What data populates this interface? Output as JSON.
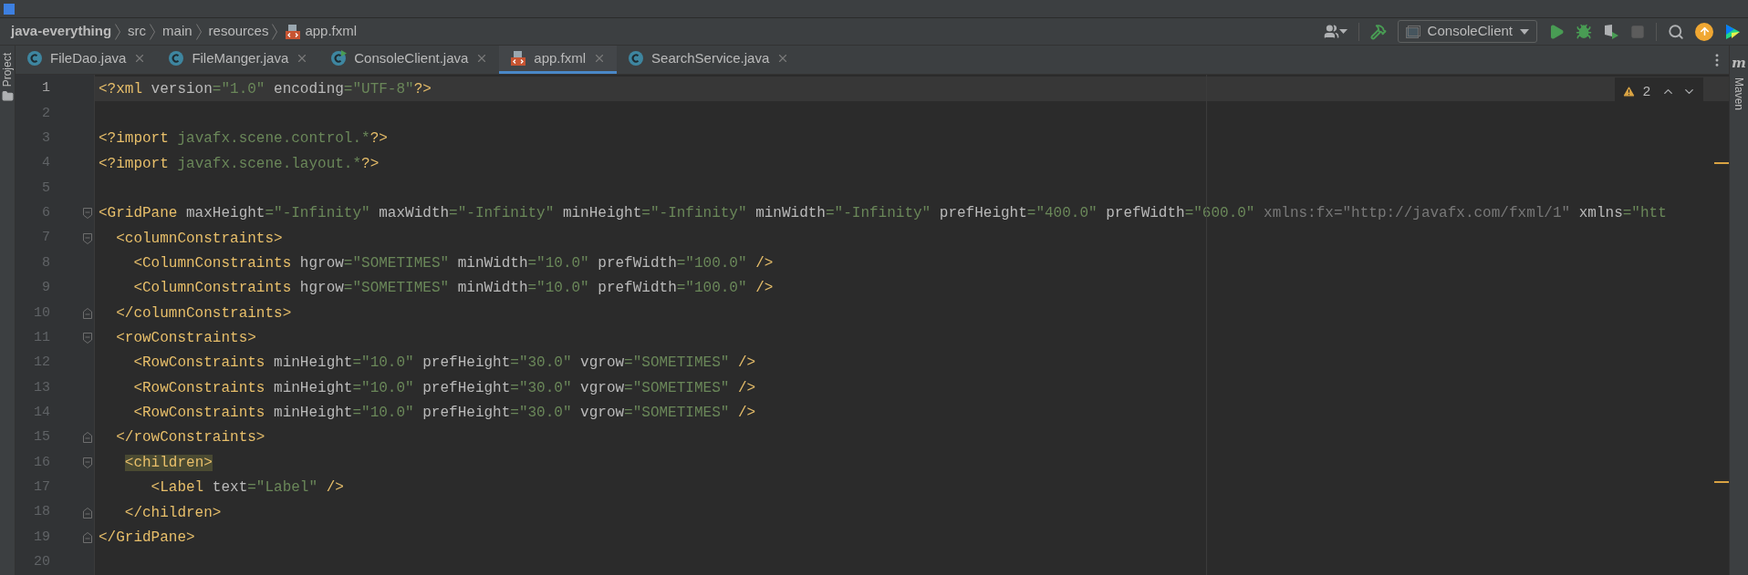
{
  "breadcrumb": [
    {
      "label": "java-everything",
      "kind": "project"
    },
    {
      "label": "src",
      "kind": "folder"
    },
    {
      "label": "main",
      "kind": "folder"
    },
    {
      "label": "resources",
      "kind": "folder"
    },
    {
      "label": "app.fxml",
      "kind": "fxml"
    }
  ],
  "toolbar": {
    "run_config": "ConsoleClient"
  },
  "tabs": [
    {
      "label": "FileDao.java",
      "kind": "class",
      "selected": false
    },
    {
      "label": "FileManger.java",
      "kind": "class",
      "selected": false
    },
    {
      "label": "ConsoleClient.java",
      "kind": "class-run",
      "selected": false
    },
    {
      "label": "app.fxml",
      "kind": "fxml",
      "selected": true
    },
    {
      "label": "SearchService.java",
      "kind": "class",
      "selected": false
    }
  ],
  "left_strip": {
    "label": "Project"
  },
  "right_strip": {
    "label": "Maven",
    "logo": "m"
  },
  "inspections": {
    "warnings": "2"
  },
  "lines": [
    {
      "number": "1",
      "current": true,
      "fold_start": false,
      "fold_end": false,
      "tokens": [
        {
          "kind": "tag",
          "text": "<?xml "
        },
        {
          "kind": "attr",
          "text": "version"
        },
        {
          "kind": "string",
          "text": "=\"1.0\" "
        },
        {
          "kind": "attr",
          "text": "encoding"
        },
        {
          "kind": "string",
          "text": "=\"UTF-8\""
        },
        {
          "kind": "tag",
          "text": "?>"
        }
      ]
    },
    {
      "number": "2",
      "current": false,
      "fold_start": false,
      "fold_end": false
    },
    {
      "number": "3",
      "current": false,
      "fold_start": false,
      "fold_end": false,
      "tokens": [
        {
          "kind": "tag",
          "text": "<?import "
        },
        {
          "kind": "string",
          "text": "javafx.scene.control.*"
        },
        {
          "kind": "tag",
          "text": "?>"
        }
      ]
    },
    {
      "number": "4",
      "current": false,
      "fold_start": false,
      "fold_end": false,
      "tokens": [
        {
          "kind": "tag",
          "text": "<?import "
        },
        {
          "kind": "string",
          "text": "javafx.scene.layout.*"
        },
        {
          "kind": "tag",
          "text": "?>"
        }
      ]
    },
    {
      "number": "5",
      "current": false,
      "fold_start": false,
      "fold_end": false
    },
    {
      "number": "6",
      "current": false,
      "fold_start": true,
      "fold_end": false,
      "tokens": [
        {
          "kind": "tag",
          "text": "<GridPane "
        },
        {
          "kind": "attr",
          "text": "maxHeight"
        },
        {
          "kind": "string",
          "text": "=\"-Infinity\" "
        },
        {
          "kind": "attr",
          "text": "maxWidth"
        },
        {
          "kind": "string",
          "text": "=\"-Infinity\" "
        },
        {
          "kind": "attr",
          "text": "minHeight"
        },
        {
          "kind": "string",
          "text": "=\"-Infinity\" "
        },
        {
          "kind": "attr",
          "text": "minWidth"
        },
        {
          "kind": "string",
          "text": "=\"-Infinity\" "
        },
        {
          "kind": "attr",
          "text": "prefHeight"
        },
        {
          "kind": "string",
          "text": "=\"400.0\" "
        },
        {
          "kind": "attr",
          "text": "prefWidth"
        },
        {
          "kind": "string",
          "text": "=\"600.0\" "
        },
        {
          "kind": "ns",
          "text": "xmlns:fx=\"http://javafx.com/fxml/1\" "
        },
        {
          "kind": "attr",
          "text": "xmlns"
        },
        {
          "kind": "string",
          "text": "=\"htt"
        }
      ]
    },
    {
      "number": "7",
      "current": false,
      "fold_start": true,
      "fold_end": false,
      "tokens": [
        {
          "kind": "tag",
          "text": "  <columnConstraints>"
        }
      ]
    },
    {
      "number": "8",
      "current": false,
      "fold_start": false,
      "fold_end": false,
      "tokens": [
        {
          "kind": "tag",
          "text": "    <ColumnConstraints "
        },
        {
          "kind": "attr",
          "text": "hgrow"
        },
        {
          "kind": "string",
          "text": "=\"SOMETIMES\" "
        },
        {
          "kind": "attr",
          "text": "minWidth"
        },
        {
          "kind": "string",
          "text": "=\"10.0\" "
        },
        {
          "kind": "attr",
          "text": "prefWidth"
        },
        {
          "kind": "string",
          "text": "=\"100.0\" "
        },
        {
          "kind": "tag",
          "text": "/>"
        }
      ]
    },
    {
      "number": "9",
      "current": false,
      "fold_start": false,
      "fold_end": false,
      "tokens": [
        {
          "kind": "tag",
          "text": "    <ColumnConstraints "
        },
        {
          "kind": "attr",
          "text": "hgrow"
        },
        {
          "kind": "string",
          "text": "=\"SOMETIMES\" "
        },
        {
          "kind": "attr",
          "text": "minWidth"
        },
        {
          "kind": "string",
          "text": "=\"10.0\" "
        },
        {
          "kind": "attr",
          "text": "prefWidth"
        },
        {
          "kind": "string",
          "text": "=\"100.0\" "
        },
        {
          "kind": "tag",
          "text": "/>"
        }
      ]
    },
    {
      "number": "10",
      "current": false,
      "fold_start": false,
      "fold_end": true,
      "tokens": [
        {
          "kind": "tag",
          "text": "  </columnConstraints>"
        }
      ]
    },
    {
      "number": "11",
      "current": false,
      "fold_start": true,
      "fold_end": false,
      "tokens": [
        {
          "kind": "tag",
          "text": "  <rowConstraints>"
        }
      ]
    },
    {
      "number": "12",
      "current": false,
      "fold_start": false,
      "fold_end": false,
      "tokens": [
        {
          "kind": "tag",
          "text": "    <RowConstraints "
        },
        {
          "kind": "attr",
          "text": "minHeight"
        },
        {
          "kind": "string",
          "text": "=\"10.0\" "
        },
        {
          "kind": "attr",
          "text": "prefHeight"
        },
        {
          "kind": "string",
          "text": "=\"30.0\" "
        },
        {
          "kind": "attr",
          "text": "vgrow"
        },
        {
          "kind": "string",
          "text": "=\"SOMETIMES\" "
        },
        {
          "kind": "tag",
          "text": "/>"
        }
      ]
    },
    {
      "number": "13",
      "current": false,
      "fold_start": false,
      "fold_end": false,
      "tokens": [
        {
          "kind": "tag",
          "text": "    <RowConstraints "
        },
        {
          "kind": "attr",
          "text": "minHeight"
        },
        {
          "kind": "string",
          "text": "=\"10.0\" "
        },
        {
          "kind": "attr",
          "text": "prefHeight"
        },
        {
          "kind": "string",
          "text": "=\"30.0\" "
        },
        {
          "kind": "attr",
          "text": "vgrow"
        },
        {
          "kind": "string",
          "text": "=\"SOMETIMES\" "
        },
        {
          "kind": "tag",
          "text": "/>"
        }
      ]
    },
    {
      "number": "14",
      "current": false,
      "fold_start": false,
      "fold_end": false,
      "tokens": [
        {
          "kind": "tag",
          "text": "    <RowConstraints "
        },
        {
          "kind": "attr",
          "text": "minHeight"
        },
        {
          "kind": "string",
          "text": "=\"10.0\" "
        },
        {
          "kind": "attr",
          "text": "prefHeight"
        },
        {
          "kind": "string",
          "text": "=\"30.0\" "
        },
        {
          "kind": "attr",
          "text": "vgrow"
        },
        {
          "kind": "string",
          "text": "=\"SOMETIMES\" "
        },
        {
          "kind": "tag",
          "text": "/>"
        }
      ]
    },
    {
      "number": "15",
      "current": false,
      "fold_start": false,
      "fold_end": true,
      "tokens": [
        {
          "kind": "tag",
          "text": "  </rowConstraints>"
        }
      ]
    },
    {
      "number": "16",
      "current": false,
      "fold_start": true,
      "fold_end": false,
      "tokens": [
        {
          "kind": "match",
          "text": "   <children>"
        }
      ]
    },
    {
      "number": "17",
      "current": false,
      "fold_start": false,
      "fold_end": false,
      "tokens": [
        {
          "kind": "tag",
          "text": "      <Label "
        },
        {
          "kind": "attr",
          "text": "text"
        },
        {
          "kind": "string",
          "text": "=\"Label\" "
        },
        {
          "kind": "tag",
          "text": "/>"
        }
      ]
    },
    {
      "number": "18",
      "current": false,
      "fold_start": false,
      "fold_end": true,
      "tokens": [
        {
          "kind": "tag",
          "text": "   </children>"
        }
      ]
    },
    {
      "number": "19",
      "current": false,
      "fold_start": false,
      "fold_end": true,
      "tokens": [
        {
          "kind": "tag",
          "text": "</GridPane>"
        }
      ]
    },
    {
      "number": "20",
      "current": false,
      "fold_start": false,
      "fold_end": false
    }
  ]
}
